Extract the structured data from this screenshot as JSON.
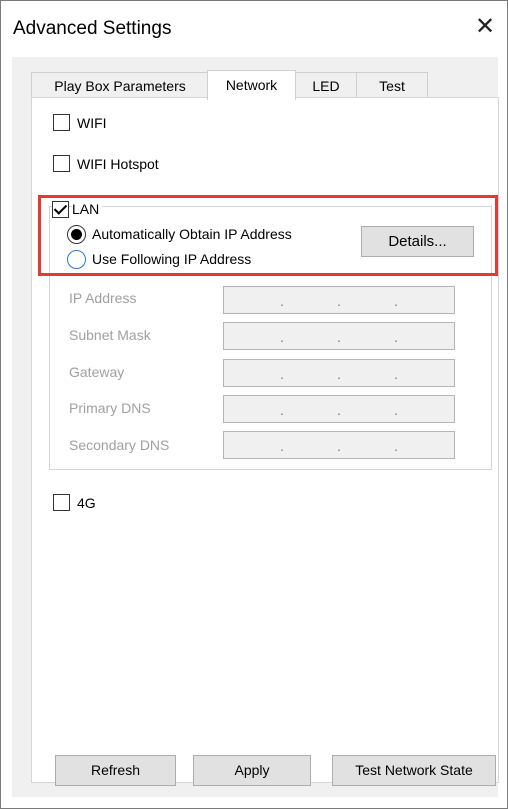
{
  "window": {
    "title": "Advanced Settings",
    "close_glyph": "✕"
  },
  "tabs": [
    {
      "label": "Play Box Parameters",
      "active": false
    },
    {
      "label": "Network",
      "active": true
    },
    {
      "label": "LED",
      "active": false
    },
    {
      "label": "Test",
      "active": false
    }
  ],
  "network": {
    "wifi": {
      "label": "WIFI",
      "checked": false
    },
    "hotspot": {
      "label": "WIFI Hotspot",
      "checked": false
    },
    "lan": {
      "label": "LAN",
      "checked": true,
      "auto_ip": {
        "label": "Automatically Obtain IP Address",
        "selected": true
      },
      "manual_ip": {
        "label": "Use Following IP Address",
        "selected": false
      },
      "details_button": "Details...",
      "fields": [
        {
          "label": "IP Address",
          "value": ".     .     ."
        },
        {
          "label": "Subnet Mask",
          "value": ".     .     ."
        },
        {
          "label": "Gateway",
          "value": ".     .     ."
        },
        {
          "label": "Primary DNS",
          "value": ".     .     ."
        },
        {
          "label": "Secondary DNS",
          "value": ".     .     ."
        }
      ]
    },
    "g4": {
      "label": "4G",
      "checked": false
    }
  },
  "footer": {
    "refresh": "Refresh",
    "apply": "Apply",
    "test_network": "Test Network State"
  },
  "colors": {
    "highlight": "#e53935",
    "radio_off": "#2a7bd5",
    "panel": "#f0f0f0"
  }
}
